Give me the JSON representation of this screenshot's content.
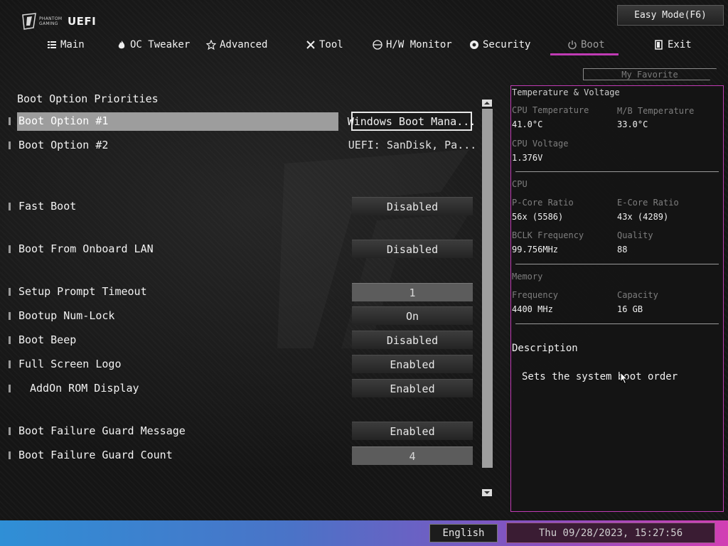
{
  "brand": {
    "small_text": "PHANTOM GAMING",
    "title": "UEFI"
  },
  "header": {
    "easy_mode_label": "Easy Mode(F6)",
    "my_favorite_label": "My Favorite"
  },
  "tabs": [
    {
      "label": "Main",
      "icon": "list-icon"
    },
    {
      "label": "OC Tweaker",
      "icon": "flame-icon"
    },
    {
      "label": "Advanced",
      "icon": "star-icon"
    },
    {
      "label": "Tool",
      "icon": "tools-icon"
    },
    {
      "label": "H/W Monitor",
      "icon": "monitor-icon"
    },
    {
      "label": "Security",
      "icon": "shield-icon"
    },
    {
      "label": "Boot",
      "icon": "power-icon",
      "active": true
    },
    {
      "label": "Exit",
      "icon": "exit-icon"
    }
  ],
  "main": {
    "section_title": "Boot Option Priorities",
    "rows": [
      {
        "label": "Boot Option #1",
        "value": "Windows Boot Mana...",
        "selected": true
      },
      {
        "label": "Boot Option #2",
        "value": "UEFI: SanDisk, Pa..."
      },
      {
        "label": "Fast Boot",
        "value": "Disabled"
      },
      {
        "label": "Boot From Onboard LAN",
        "value": "Disabled"
      },
      {
        "label": "Setup Prompt Timeout",
        "value": "1"
      },
      {
        "label": "Bootup Num-Lock",
        "value": "On"
      },
      {
        "label": "Boot Beep",
        "value": "Disabled"
      },
      {
        "label": "Full Screen Logo",
        "value": "Enabled"
      },
      {
        "label": "AddOn ROM Display",
        "value": "Enabled"
      },
      {
        "label": "Boot Failure Guard Message",
        "value": "Enabled"
      },
      {
        "label": "Boot Failure Guard Count",
        "value": "4"
      }
    ]
  },
  "panel": {
    "temp_title": "Temperature & Voltage",
    "cpu_temp_label": "CPU Temperature",
    "cpu_temp_value": "41.0°C",
    "mb_temp_label": "M/B Temperature",
    "mb_temp_value": "33.0°C",
    "cpu_voltage_label": "CPU Voltage",
    "cpu_voltage_value": "1.376V",
    "cpu_title": "CPU",
    "pcore_label": "P-Core Ratio",
    "pcore_value": "56x (5586)",
    "ecore_label": "E-Core Ratio",
    "ecore_value": "43x (4289)",
    "bclk_label": "BCLK Frequency",
    "bclk_value": "99.756MHz",
    "quality_label": "Quality",
    "quality_value": "88",
    "memory_title": "Memory",
    "freq_label": "Frequency",
    "freq_value": "4400 MHz",
    "capacity_label": "Capacity",
    "capacity_value": "16 GB",
    "desc_title": "Description",
    "desc_text": "Sets the system boot order"
  },
  "footer": {
    "language": "English",
    "datetime": "Thu 09/28/2023, 15:27:56"
  },
  "colors": {
    "accent": "#c03bb4",
    "footer_start": "#2f8fd6",
    "footer_end": "#d23fb3"
  }
}
